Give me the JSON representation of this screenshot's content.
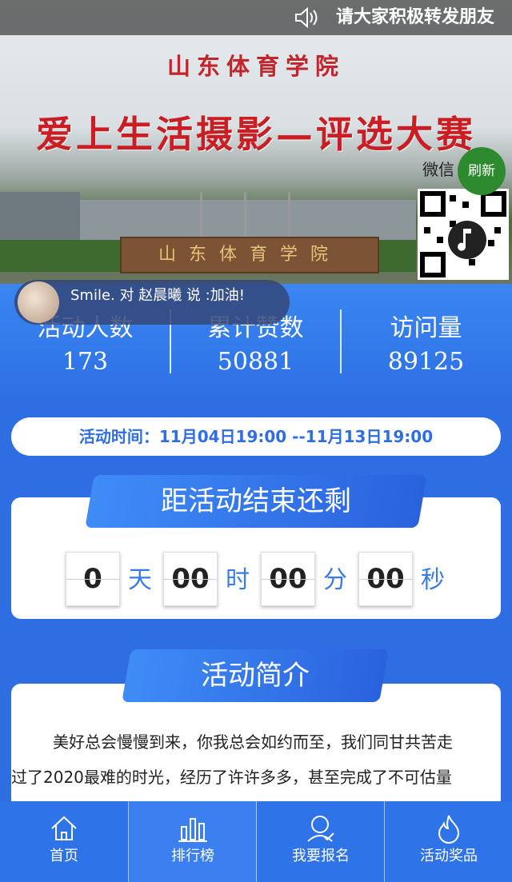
{
  "marquee": {
    "text": "请大家积极转发朋友"
  },
  "banner": {
    "school": "山东体育学院",
    "contest": "爱上生活摄影—评选大赛",
    "weixin": "微信",
    "refresh": "刷新",
    "gate_sign": "山东体育学院"
  },
  "danmu": {
    "text": "Smile. 对 赵晨曦 说 :加油!"
  },
  "stats": [
    {
      "label": "活动人数",
      "value": "173"
    },
    {
      "label": "累计赞数",
      "value": "50881"
    },
    {
      "label": "访问量",
      "value": "89125"
    }
  ],
  "activity_time": "活动时间：11月04日19:00 --11月13日19:00",
  "countdown": {
    "title": "距活动结束还剩",
    "days": "0",
    "days_unit": "天",
    "hours": "00",
    "hours_unit": "时",
    "minutes": "00",
    "minutes_unit": "分",
    "seconds": "00",
    "seconds_unit": "秒"
  },
  "intro": {
    "title": "活动简介",
    "line1": "美好总会慢慢到来，你我总会如约而至，我们同甘共苦走",
    "line2": "过了2020最难的时光，经历了许许多多，甚至完成了不可估量"
  },
  "nav": [
    {
      "label": "首页",
      "icon": "home-icon"
    },
    {
      "label": "排行榜",
      "icon": "bar-chart-icon"
    },
    {
      "label": "我要报名",
      "icon": "user-check-icon"
    },
    {
      "label": "活动奖品",
      "icon": "flame-icon"
    }
  ],
  "colors": {
    "primary": "#2f6ee2",
    "accent_red": "#c81e24",
    "refresh_green": "#2e8a2e"
  }
}
